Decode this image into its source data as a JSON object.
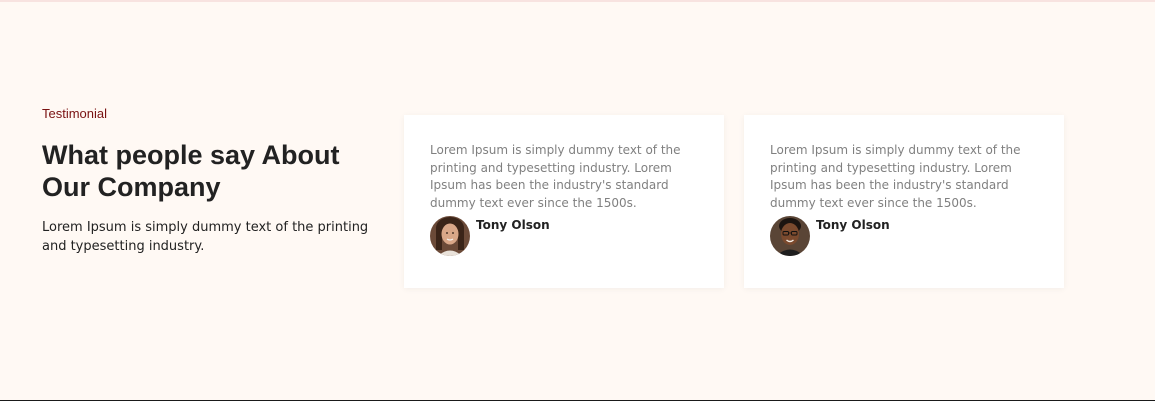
{
  "section": {
    "eyebrow": "Testimonial",
    "heading": "What people say About Our Company",
    "intro": "Lorem Ipsum is simply dummy text of the printing and typesetting industry."
  },
  "testimonials": [
    {
      "quote": "Lorem Ipsum is simply dummy text of the printing and typesetting industry. Lorem Ipsum has been the industry's standard dummy text ever since the 1500s.",
      "author": "Tony Olson",
      "avatar_icon": "person-avatar"
    },
    {
      "quote": "Lorem Ipsum is simply dummy text of the printing and typesetting industry. Lorem Ipsum has been the industry's standard dummy text ever since the 1500s.",
      "author": "Tony Olson",
      "avatar_icon": "person-avatar"
    }
  ],
  "colors": {
    "background": "#fff9f4",
    "accent": "#7a1212",
    "heading": "#222222",
    "quote_text": "#808080",
    "card": "#ffffff"
  }
}
